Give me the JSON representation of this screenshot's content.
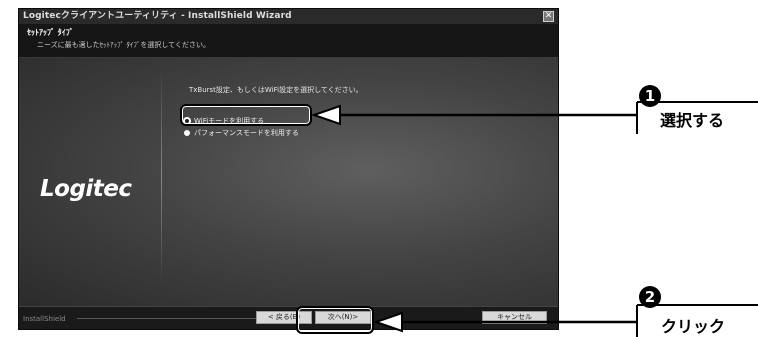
{
  "window": {
    "title": "Logitecクライアントユーティリティ - InstallShield Wizard",
    "close_glyph": "✕"
  },
  "header": {
    "title": "ｾｯﾄｱｯﾌﾟ ﾀｲﾌﾟ",
    "subtitle": "ニーズに最も適したｾｯﾄｱｯﾌﾟ ﾀｲﾌﾟを選択してください。"
  },
  "content": {
    "logo": "Logitec",
    "instruction": "TxBurst設定、もしくはWiFi設定を選択してください。",
    "options": [
      {
        "label": "WiFiモードを利用する",
        "selected": true
      },
      {
        "label": "パフォーマンスモードを利用する",
        "selected": false
      }
    ]
  },
  "footer": {
    "brand": "InstallShield",
    "back_label": "< 戻る(B)",
    "next_label": "次へ(N)>",
    "cancel_label": "キャンセル"
  },
  "callouts": [
    {
      "number": "1",
      "label": "選択する"
    },
    {
      "number": "2",
      "label": "クリック"
    }
  ],
  "colors": {
    "callout": "#000000",
    "window_bg": "#1e1e1e"
  },
  "icons": [
    "close-icon",
    "radio-selected-icon",
    "radio-unselected-icon",
    "arrow-icon"
  ]
}
